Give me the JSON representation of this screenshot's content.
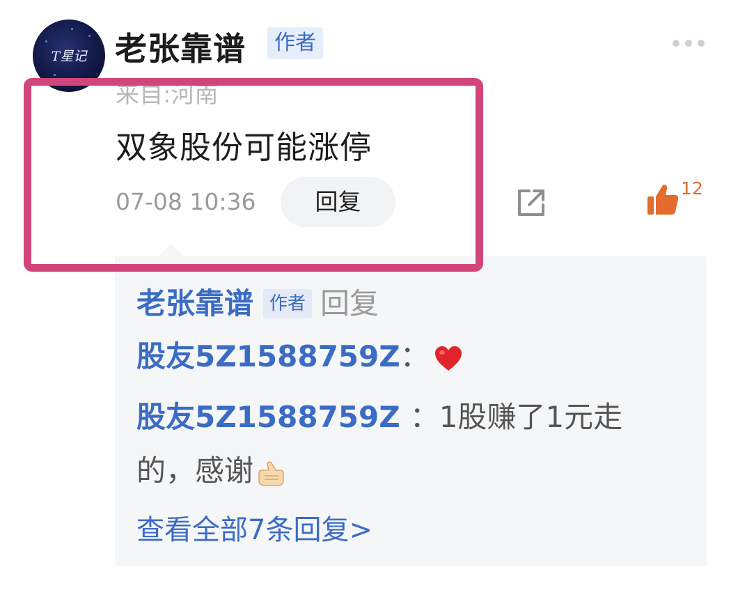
{
  "comment": {
    "author": "老张靠谱",
    "author_badge": "作者",
    "avatar_text": "T星记",
    "location": "来自:河南",
    "text": "双象股份可能涨停",
    "timestamp": "07-08 10:36",
    "reply_label": "回复",
    "like_count": "12"
  },
  "replies": {
    "first": {
      "author": "老张靠谱",
      "badge": "作者",
      "action": "回复",
      "target": "股友5Z1588759Z",
      "colon": "："
    },
    "second": {
      "author": "股友5Z1588759Z",
      "text_line1": "：1股赚了1元走",
      "text_line2": "的，感谢"
    },
    "view_all": "查看全部7条回复>"
  },
  "colors": {
    "highlight": "#d2457a",
    "link_blue": "#3b6cc4",
    "like_orange": "#e36b2b",
    "panel_bg": "#f5f6f8"
  },
  "icons": [
    "more-icon",
    "share-icon",
    "thumbs-up-icon",
    "heart-icon",
    "thumbs-up-emoji-icon"
  ]
}
